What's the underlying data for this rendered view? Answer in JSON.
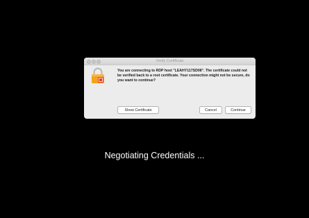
{
  "dialog": {
    "title": "Verify Certificate",
    "message": "You are connecting to RDP host \"LEAHY117SD08\". The certificate could not be verified back to a root certificate. Your connection might not be secure, do you want to continue?",
    "buttons": {
      "show_certificate": "Show Certificate",
      "cancel": "Cancel",
      "continue": "Continue"
    },
    "icon": "lock-certificate-icon"
  },
  "status": {
    "text": "Negotiating Credentials ..."
  },
  "colors": {
    "background": "#000000",
    "dialog_bg": "#ececec",
    "lock_orange": "#f5a21c",
    "badge_red": "#e0412c",
    "status_text": "#ffffff"
  }
}
